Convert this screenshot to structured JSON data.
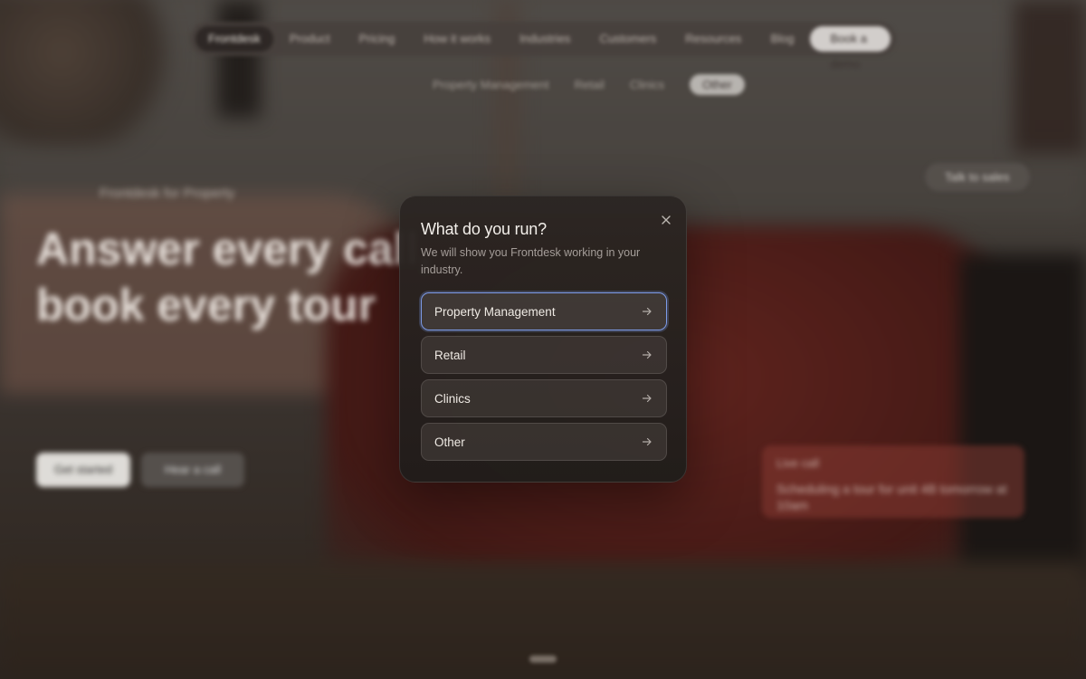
{
  "background": {
    "nav": {
      "items": [
        "Frontdesk",
        "Product",
        "Pricing",
        "How it works",
        "Industries",
        "Customers",
        "Resources",
        "Blog"
      ],
      "cta": "Book a demo"
    },
    "subnav": {
      "items": [
        "Property Management",
        "Retail",
        "Clinics"
      ],
      "cta": "Other"
    },
    "top_right_button": "Talk to sales",
    "hero": {
      "eyebrow": "Frontdesk for Property",
      "headline": "Answer every call, book every tour"
    },
    "hero_buttons": {
      "primary": "Get started",
      "secondary": "Hear a call"
    },
    "card": {
      "title": "Live call",
      "text": "Scheduling a tour for unit 4B tomorrow at 10am"
    }
  },
  "modal": {
    "title": "What do you run?",
    "subtitle": "We will show you Frontdesk working in your industry.",
    "close_icon": "close-icon",
    "options": [
      {
        "label": "Property Management",
        "icon": "arrow-right-icon",
        "focused": true
      },
      {
        "label": "Retail",
        "icon": "arrow-right-icon",
        "focused": false
      },
      {
        "label": "Clinics",
        "icon": "arrow-right-icon",
        "focused": false
      },
      {
        "label": "Other",
        "icon": "arrow-right-icon",
        "focused": false
      }
    ]
  },
  "colors": {
    "focus_ring": "#7d9be8",
    "modal_bg": "#2c2623",
    "couch": "#8a2e27"
  }
}
